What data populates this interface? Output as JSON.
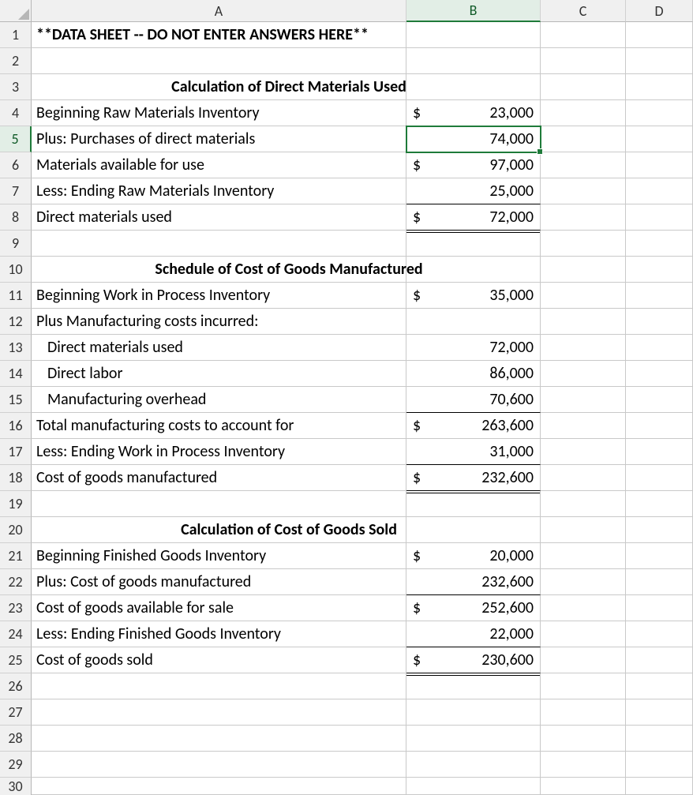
{
  "columns": [
    "A",
    "B",
    "C",
    "D"
  ],
  "selected_cell": "B5",
  "selected_row": 5,
  "selected_col": "B",
  "rows": [
    {
      "n": 1,
      "a": "**DATA SHEET -- DO NOT ENTER ANSWERS HERE**",
      "a_style": "bold"
    },
    {
      "n": 2
    },
    {
      "n": 3,
      "heading": "Calculation of Direct Materials Used"
    },
    {
      "n": 4,
      "a": "Beginning Raw Materials Inventory",
      "sym": "$",
      "val": "23,000"
    },
    {
      "n": 5,
      "a": "Plus: Purchases of direct materials",
      "val": "74,000",
      "b_style": "u-single"
    },
    {
      "n": 6,
      "a": "Materials available for use",
      "sym": "$",
      "val": "97,000"
    },
    {
      "n": 7,
      "a": "Less: Ending Raw Materials Inventory",
      "val": "25,000",
      "b_style": "u-single"
    },
    {
      "n": 8,
      "a": "Direct materials used",
      "sym": "$",
      "val": "72,000",
      "b_style": "u-double"
    },
    {
      "n": 9
    },
    {
      "n": 10,
      "heading": "Schedule of Cost of Goods Manufactured"
    },
    {
      "n": 11,
      "a": "Beginning Work in Process Inventory",
      "sym": "$",
      "val": "35,000"
    },
    {
      "n": 12,
      "a": "Plus Manufacturing costs incurred:"
    },
    {
      "n": 13,
      "a": "Direct materials used",
      "a_indent": true,
      "val": "72,000"
    },
    {
      "n": 14,
      "a": "Direct labor",
      "a_indent": true,
      "val": "86,000"
    },
    {
      "n": 15,
      "a": "Manufacturing overhead",
      "a_indent": true,
      "val": "70,600",
      "b_style": "u-single"
    },
    {
      "n": 16,
      "a": "Total manufacturing costs to account for",
      "sym": "$",
      "val": "263,600"
    },
    {
      "n": 17,
      "a": "Less: Ending Work in Process Inventory",
      "val": "31,000",
      "b_style": "u-single"
    },
    {
      "n": 18,
      "a": "Cost of goods manufactured",
      "sym": "$",
      "val": "232,600",
      "b_style": "u-double"
    },
    {
      "n": 19
    },
    {
      "n": 20,
      "heading": "Calculation of Cost of Goods Sold"
    },
    {
      "n": 21,
      "a": "Beginning Finished Goods Inventory",
      "sym": "$",
      "val": "20,000"
    },
    {
      "n": 22,
      "a": "Plus: Cost of goods manufactured",
      "val": "232,600",
      "b_style": "u-single"
    },
    {
      "n": 23,
      "a": "Cost of goods available for sale",
      "sym": "$",
      "val": "252,600"
    },
    {
      "n": 24,
      "a": "Less: Ending Finished Goods Inventory",
      "val": "22,000",
      "b_style": "u-single"
    },
    {
      "n": 25,
      "a": "Cost of goods sold",
      "sym": "$",
      "val": "230,600",
      "b_style": "u-double"
    },
    {
      "n": 26
    },
    {
      "n": 27
    },
    {
      "n": 28
    },
    {
      "n": 29
    },
    {
      "n": 30,
      "partial": true
    }
  ]
}
